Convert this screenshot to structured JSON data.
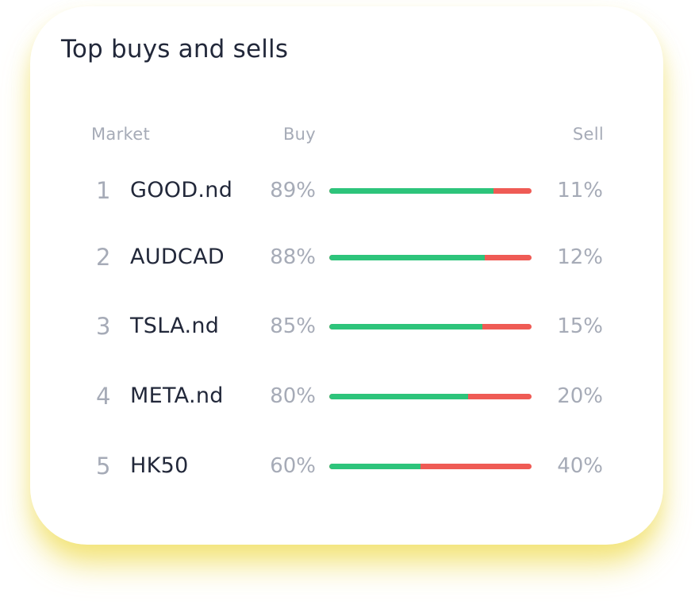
{
  "panel": {
    "title": "Top buys and sells"
  },
  "headers": {
    "market": "Market",
    "buy": "Buy",
    "sell": "Sell"
  },
  "colors": {
    "buy": "#2dc47b",
    "sell": "#ef5b55",
    "glow": "#f0de5a"
  },
  "rows": [
    {
      "rank": "1",
      "market": "GOOD.nd",
      "buy": "89%",
      "sell": "11%",
      "buy_fraction": 0.81
    },
    {
      "rank": "2",
      "market": "AUDCAD",
      "buy": "88%",
      "sell": "12%",
      "buy_fraction": 0.77
    },
    {
      "rank": "3",
      "market": "TSLA.nd",
      "buy": "85%",
      "sell": "15%",
      "buy_fraction": 0.755
    },
    {
      "rank": "4",
      "market": "META.nd",
      "buy": "80%",
      "sell": "20%",
      "buy_fraction": 0.685
    },
    {
      "rank": "5",
      "market": "HK50",
      "buy": "60%",
      "sell": "40%",
      "buy_fraction": 0.45
    }
  ]
}
